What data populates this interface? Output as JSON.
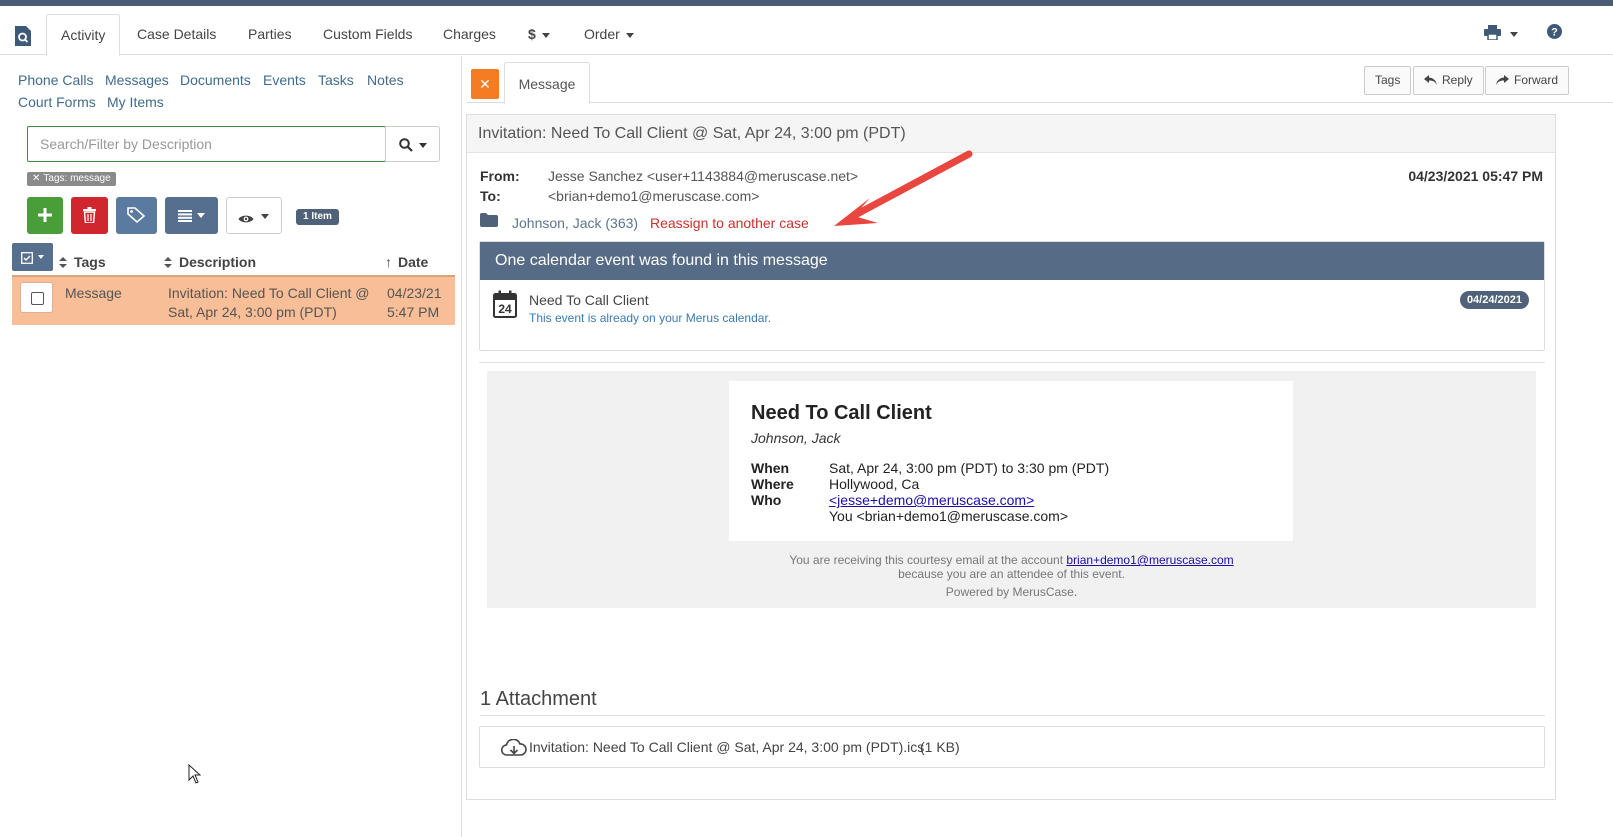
{
  "main_nav": {
    "tabs": [
      {
        "label": "Activity",
        "active": true
      },
      {
        "label": "Case Details"
      },
      {
        "label": "Parties"
      },
      {
        "label": "Custom Fields"
      },
      {
        "label": "Charges"
      },
      {
        "label": "$"
      },
      {
        "label": "Order"
      }
    ],
    "icons": [
      "document-search-icon",
      "printer-icon",
      "help-icon"
    ]
  },
  "sub_nav": {
    "links": [
      "Phone Calls",
      "Messages",
      "Documents",
      "Events",
      "Tasks",
      "Notes",
      "Court Forms",
      "My Items"
    ]
  },
  "search": {
    "placeholder": "Search/Filter by Description",
    "filter_chip": "Tags: message"
  },
  "toolbar": {
    "item_count": "1 Item",
    "colors": {
      "add": "#4a9e3a",
      "delete": "#d0262e",
      "tag": "#5b7aa0",
      "list": "#566f8e"
    }
  },
  "activity_list": {
    "columns": [
      "Tags",
      "Description",
      "Date"
    ],
    "rows": [
      {
        "tag": "Message",
        "description_line1": "Invitation: Need To Call Client @",
        "description_line2": "Sat, Apr 24, 3:00 pm (PDT)",
        "date": "04/23/21",
        "time": "5:47 PM"
      }
    ]
  },
  "message_panel": {
    "tab_label": "Message",
    "buttons": {
      "tags": "Tags",
      "reply": "Reply",
      "forward": "Forward"
    },
    "subject": "Invitation: Need To Call Client @ Sat, Apr 24, 3:00 pm (PDT)",
    "from_label": "From:",
    "from_value": "Jesse Sanchez <user+1143884@meruscase.net>",
    "to_label": "To:",
    "to_value": "<brian+demo1@meruscase.com>",
    "timestamp": "04/23/2021 05:47 PM",
    "case_name": "Johnson, Jack (363)",
    "reassign_link": "Reassign to another case",
    "accent_color": "#c9302c"
  },
  "calendar_notice": {
    "heading": "One calendar event was found in this message",
    "calendar_day": "24",
    "event_title": "Need To Call Client",
    "event_note": "This event is already on your Merus calendar.",
    "event_date": "04/24/2021"
  },
  "email_body": {
    "title": "Need To Call Client",
    "subtitle": "Johnson, Jack",
    "when_label": "When",
    "when_value": "Sat, Apr 24, 3:00 pm (PDT) to 3:30 pm (PDT)",
    "where_label": "Where",
    "where_value": "Hollywood, Ca",
    "who_label": "Who",
    "who_value_1": "<jesse+demo@meruscase.com>",
    "who_value_2": "You <brian+demo1@meruscase.com>",
    "footer_1_text": "You are receiving this courtesy email at the account",
    "footer_1_link": "brian+demo1@meruscase.com",
    "footer_2": "because you are an attendee of this event.",
    "footer_3": "Powered by MerusCase."
  },
  "attachments": {
    "title": "1 Attachment",
    "file_name": "Invitation: Need To Call Client @ Sat, Apr 24, 3:00 pm (PDT).ics",
    "file_size": "(1 KB)"
  }
}
